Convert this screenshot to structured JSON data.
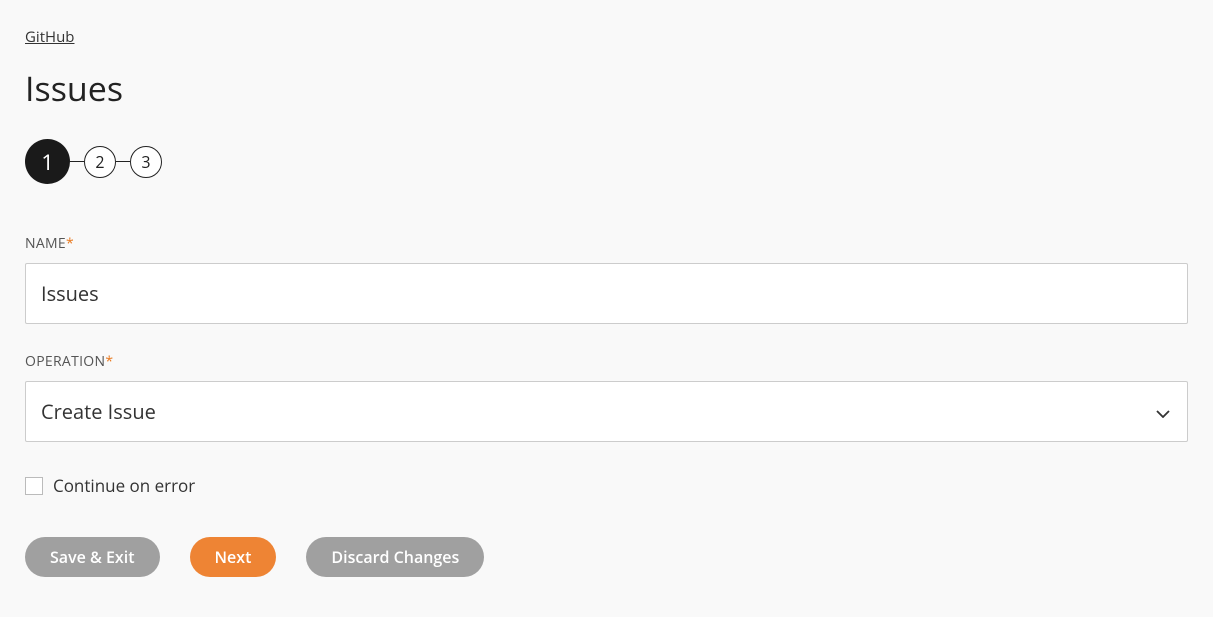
{
  "breadcrumb": "GitHub",
  "title": "Issues",
  "stepper": {
    "steps": [
      "1",
      "2",
      "3"
    ],
    "activeIndex": 0
  },
  "form": {
    "name": {
      "label": "NAME",
      "required": "*",
      "value": "Issues"
    },
    "operation": {
      "label": "OPERATION",
      "required": "*",
      "value": "Create Issue"
    },
    "continueOnError": {
      "label": "Continue on error",
      "checked": false
    }
  },
  "buttons": {
    "saveExit": "Save & Exit",
    "next": "Next",
    "discard": "Discard Changes"
  }
}
